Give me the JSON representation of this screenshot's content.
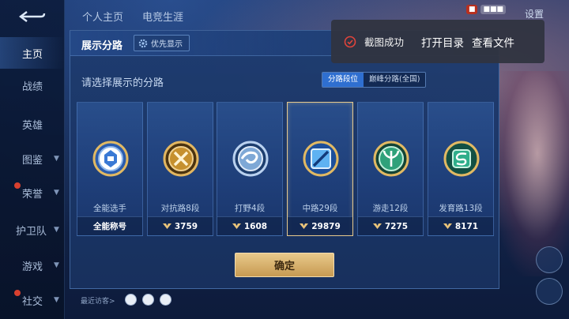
{
  "sidebar": {
    "items": [
      {
        "label": "主页",
        "active": true
      },
      {
        "label": "战绩"
      },
      {
        "label": "英雄"
      },
      {
        "label": "图鉴",
        "chevron": true
      },
      {
        "label": "荣誉",
        "chevron": true,
        "dot": true
      },
      {
        "label": "护卫队",
        "chevron": true
      },
      {
        "label": "游戏",
        "chevron": true
      },
      {
        "label": "社交",
        "chevron": true,
        "dot": true
      }
    ]
  },
  "topnav": {
    "tabs": [
      "个人主页",
      "电竞生涯"
    ],
    "settings": "设置"
  },
  "dialog": {
    "title": "展示分路",
    "priority_label": "优先显示",
    "prompt": "请选择展示的分路",
    "segments": [
      "分路段位",
      "巅峰分路(全国)"
    ],
    "confirm_label": "确定",
    "cards": [
      {
        "label": "全能选手",
        "value": "全能称号",
        "icon": "allround-emblem-icon",
        "power": false
      },
      {
        "label": "对抗路8段",
        "value": "3759",
        "icon": "clash-lane-emblem-icon",
        "power": true
      },
      {
        "label": "打野4段",
        "value": "1608",
        "icon": "jungle-emblem-icon",
        "power": true
      },
      {
        "label": "中路29段",
        "value": "29879",
        "icon": "mid-lane-emblem-icon",
        "power": true,
        "selected": true
      },
      {
        "label": "游走12段",
        "value": "7275",
        "icon": "roam-emblem-icon",
        "power": true
      },
      {
        "label": "发育路13段",
        "value": "8171",
        "icon": "farm-lane-emblem-icon",
        "power": true
      }
    ]
  },
  "toast": {
    "message": "截图成功",
    "open_dir": "打开目录",
    "view_file": "查看文件"
  },
  "bottom": {
    "recent_label": "最近访客>"
  },
  "colors": {
    "accent_blue": "#2f6fd0",
    "gold": "#e6c98d",
    "toast_bg": "#303440"
  }
}
